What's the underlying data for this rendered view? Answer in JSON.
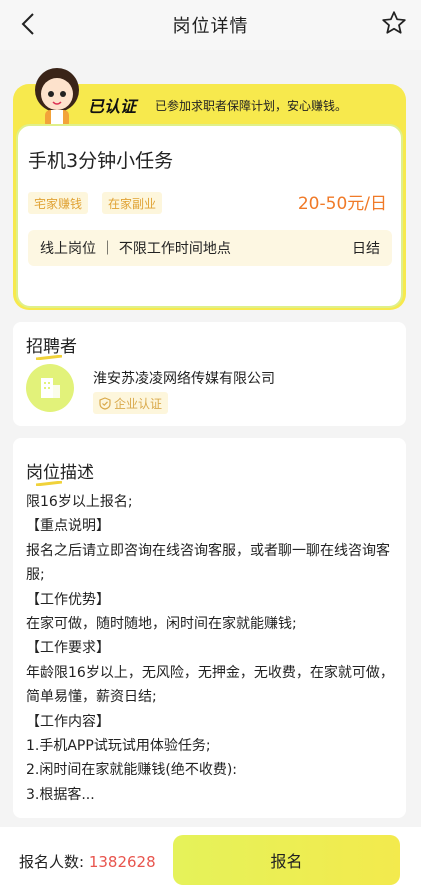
{
  "header": {
    "title": "岗位详情",
    "back_icon": "chevron-left-icon",
    "favorite_icon": "star-outline-icon"
  },
  "verification": {
    "tag": "已认证",
    "description": "已参加求职者保障计划，安心赚钱。"
  },
  "job": {
    "title": "手机3分钟小任务",
    "tags": [
      "宅家赚钱",
      "在家副业"
    ],
    "salary": "20-50元/日",
    "meta": "线上岗位 ｜ 不限工作时间地点",
    "settlement": "日结"
  },
  "recruiter": {
    "section_title": "招聘者",
    "company_name": "淮安苏凌凌网络传媒有限公司",
    "certification": "企业认证"
  },
  "description": {
    "section_title": "岗位描述",
    "lines": [
      "限16岁以上报名;",
      "【重点说明】",
      "报名之后请立即咨询在线咨询客服，或者聊一聊在线咨询客服;",
      "【工作优势】",
      "在家可做，随时随地，闲时间在家就能赚钱;",
      "【工作要求】",
      "年龄限16岁以上，无风险，无押金，无收费，在家就可做，简单易懂，薪资日结;",
      "【工作内容】",
      "1.手机APP试玩试用体验任务;",
      "2.闲时间在家就能赚钱(绝不收费):",
      "3.根据客..."
    ]
  },
  "footer": {
    "applicants_label": "报名人数:",
    "applicants_count": "1382628",
    "apply_button": "报名"
  },
  "colors": {
    "accent_yellow": "#f7e94d",
    "salary_orange": "#f07a28",
    "count_red": "#e8554e",
    "tag_text": "#e0a234"
  }
}
